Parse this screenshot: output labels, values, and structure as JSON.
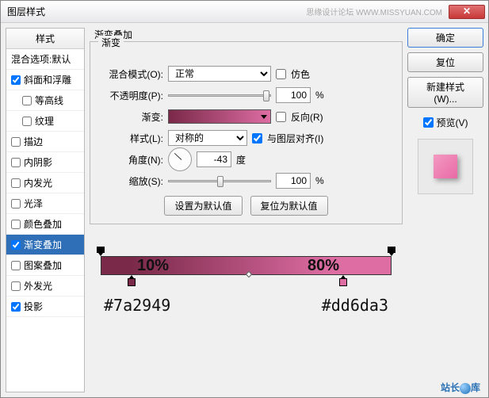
{
  "window": {
    "title": "图层样式",
    "watermark": "思缘设计论坛 WWW.MISSYUAN.COM"
  },
  "styles": {
    "header": "样式",
    "blend_opts": "混合选项:默认",
    "items": [
      {
        "label": "斜面和浮雕",
        "checked": true
      },
      {
        "label": "等高线",
        "checked": false,
        "sub": true
      },
      {
        "label": "纹理",
        "checked": false,
        "sub": true
      },
      {
        "label": "描边",
        "checked": false
      },
      {
        "label": "内阴影",
        "checked": false
      },
      {
        "label": "内发光",
        "checked": false
      },
      {
        "label": "光泽",
        "checked": false
      },
      {
        "label": "颜色叠加",
        "checked": false
      },
      {
        "label": "渐变叠加",
        "checked": true,
        "selected": true
      },
      {
        "label": "图案叠加",
        "checked": false
      },
      {
        "label": "外发光",
        "checked": false
      },
      {
        "label": "投影",
        "checked": true
      }
    ]
  },
  "panel": {
    "title": "渐变叠加",
    "section": "渐变",
    "blend_mode_label": "混合模式(O):",
    "blend_mode_value": "正常",
    "dither_label": "仿色",
    "opacity_label": "不透明度(P):",
    "opacity_value": "100",
    "pct": "%",
    "gradient_label": "渐变:",
    "reverse_label": "反向(R)",
    "style_label": "样式(L):",
    "style_value": "对称的",
    "align_label": "与图层对齐(I)",
    "angle_label": "角度(N):",
    "angle_value": "-43",
    "angle_unit": "度",
    "scale_label": "缩放(S):",
    "scale_value": "100",
    "set_default": "设置为默认值",
    "reset_default": "复位为默认值"
  },
  "buttons": {
    "ok": "确定",
    "cancel": "复位",
    "new_style": "新建样式(W)...",
    "preview": "预览(V)"
  },
  "annot": {
    "stop1_pct": "10%",
    "stop2_pct": "80%",
    "stop1_hex": "#7a2949",
    "stop2_hex": "#dd6da3"
  },
  "footer": {
    "brand_a": "站长",
    "brand_b": "库"
  },
  "chart_data": {
    "type": "gradient",
    "stops": [
      {
        "position": 10,
        "color": "#7a2949"
      },
      {
        "position": 80,
        "color": "#dd6da3"
      }
    ],
    "angle": -43,
    "style": "对称的",
    "opacity": 100,
    "scale": 100,
    "reverse": false,
    "align_with_layer": true
  }
}
